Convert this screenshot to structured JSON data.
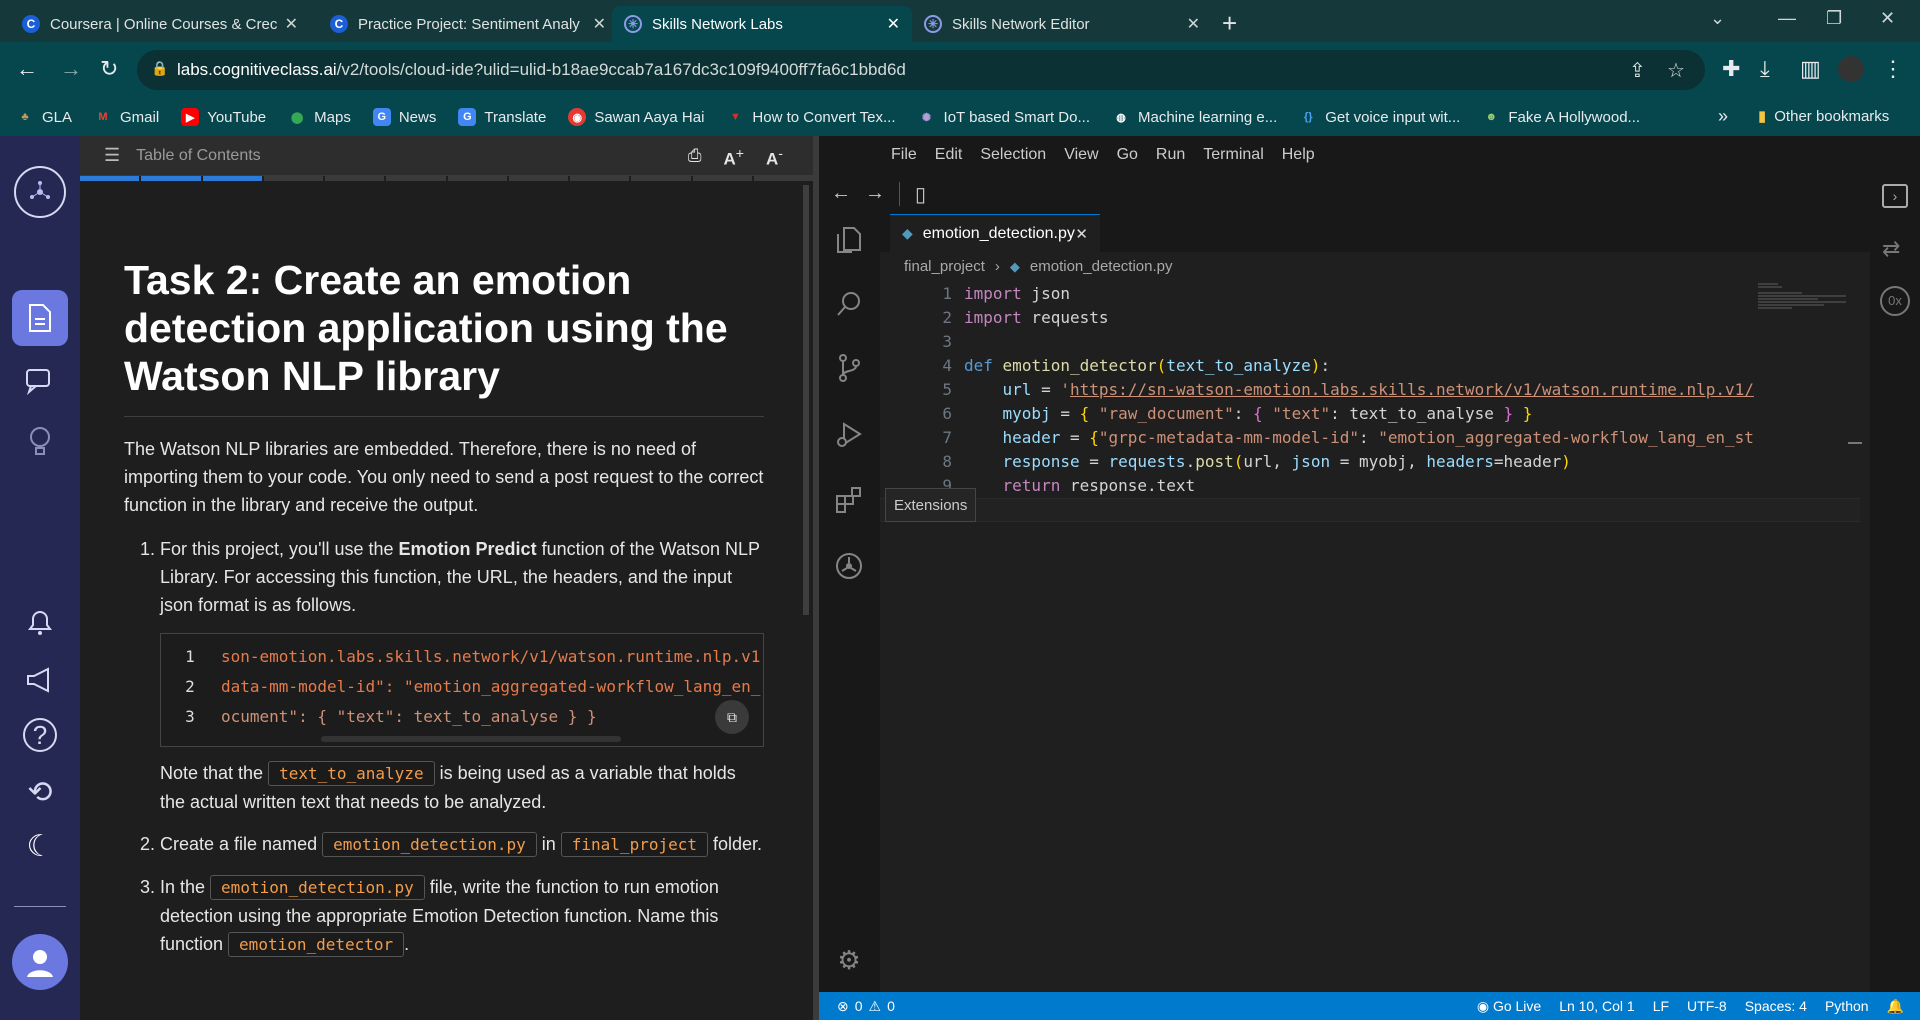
{
  "browser": {
    "tabs": [
      {
        "title": "Coursera | Online Courses & Crec",
        "icon": "coursera-icon",
        "color": "#1a5fd6"
      },
      {
        "title": "Practice Project: Sentiment Analy",
        "icon": "coursera-icon",
        "color": "#1a5fd6"
      },
      {
        "title": "Skills Network Labs",
        "icon": "skills-network-icon",
        "color": "#4b5bd1"
      },
      {
        "title": "Skills Network Editor",
        "icon": "skills-network-icon",
        "color": "#4b5bd1"
      }
    ],
    "active_tab": 2,
    "url_host": "labs.cognitiveclass.ai",
    "url_path": "/v2/tools/cloud-ide?ulid=ulid-b18ae9ccab7a167dc3c109f9400ff7fa6c1bbd6d",
    "bookmarks": [
      {
        "label": "GLA",
        "icon": "gla-icon",
        "color": "#8a5a2b"
      },
      {
        "label": "Gmail",
        "icon": "gmail-icon",
        "color": "#ea4335"
      },
      {
        "label": "YouTube",
        "icon": "youtube-icon",
        "color": "#ff0000"
      },
      {
        "label": "Maps",
        "icon": "maps-icon",
        "color": "#34a853"
      },
      {
        "label": "News",
        "icon": "news-icon",
        "color": "#4285f4"
      },
      {
        "label": "Translate",
        "icon": "translate-icon",
        "color": "#4285f4"
      },
      {
        "label": "Sawan Aaya Hai",
        "icon": "music-icon",
        "color": "#e53935"
      },
      {
        "label": "How to Convert Tex...",
        "icon": "vercel-icon",
        "color": "#d32f2f"
      },
      {
        "label": "IoT based Smart Do...",
        "icon": "gear-icon",
        "color": "#7e57c2"
      },
      {
        "label": "Machine learning e...",
        "icon": "globe-icon",
        "color": "#ffffff"
      },
      {
        "label": "Get voice input wit...",
        "icon": "braces-icon",
        "color": "#4fa3f7"
      },
      {
        "label": "Fake A Hollywood...",
        "icon": "avatar-icon",
        "color": "#9ccc65"
      }
    ],
    "other_bookmarks": "Other bookmarks"
  },
  "instructions": {
    "toc_label": "Table of Contents",
    "progress_done": 3,
    "progress_total": 12,
    "title": "Task 2: Create an emotion detection application using the Watson NLP library",
    "intro": "The Watson NLP libraries are embedded. Therefore, there is no need of importing them to your code. You only need to send a post request to the correct function in the library and receive the output.",
    "step1_pre": "For this project, you'll use the ",
    "step1_bold": "Emotion Predict",
    "step1_post": " function of the Watson NLP Library. For accessing this function, the URL, the headers, and the input json format is as follows.",
    "code_lines": [
      "son-emotion.labs.skills.network/v1/watson.runtime.nlp.v1",
      "data-mm-model-id\": \"emotion_aggregated-workflow_lang_en_",
      "ocument\": { \"text\": text_to_analyse } }"
    ],
    "note_pre": "Note that the ",
    "note_code": "text_to_analyze",
    "note_post": " is being used as a variable that holds the actual written text that needs to be analyzed.",
    "step2_pre": "Create a file named ",
    "step2_code1": "emotion_detection.py",
    "step2_mid": " in ",
    "step2_code2": "final_project",
    "step2_post": " folder.",
    "step3_pre": "In the ",
    "step3_code1": "emotion_detection.py",
    "step3_mid": " file, write the function to run emotion detection using the appropriate Emotion Detection function. Name this function ",
    "step3_code2": "emotion_detector",
    "step3_post": "."
  },
  "editor": {
    "menu": [
      "File",
      "Edit",
      "Selection",
      "View",
      "Go",
      "Run",
      "Terminal",
      "Help"
    ],
    "tab_name": "emotion_detection.py",
    "breadcrumb_folder": "final_project",
    "breadcrumb_file": "emotion_detection.py",
    "tooltip": "Extensions",
    "code": {
      "l1_kw": "import",
      "l1_mod": " json",
      "l2_kw": "import",
      "l2_mod": " requests",
      "l4_def": "def",
      "l4_fn": "emotion_detector",
      "l4_param": "text_to_analyze",
      "l5_var": "url",
      "l5_url": "https://sn-watson-emotion.labs.skills.network/v1/watson.runtime.nlp.v1/",
      "l6_var": "myobj",
      "l6_k1": "\"raw_document\"",
      "l6_k2": "\"text\"",
      "l6_v": " text_to_analyse ",
      "l7_var": "header",
      "l7_k": "\"grpc-metadata-mm-model-id\"",
      "l7_v": "\"emotion_aggregated-workflow_lang_en_st",
      "l8_var": "response",
      "l8_obj": "requests",
      "l8_fn": "post",
      "l8_a1": "url",
      "l8_k1": "json",
      "l8_a2": "myobj",
      "l8_k2": "headers",
      "l8_a3": "header",
      "l9_kw": "return",
      "l9_rest": " response.text"
    },
    "status": {
      "errors": "0",
      "warnings": "0",
      "golive": "Go Live",
      "position": "Ln 10, Col 1",
      "eol": "LF",
      "encoding": "UTF-8",
      "spaces": "Spaces: 4",
      "language": "Python"
    }
  }
}
